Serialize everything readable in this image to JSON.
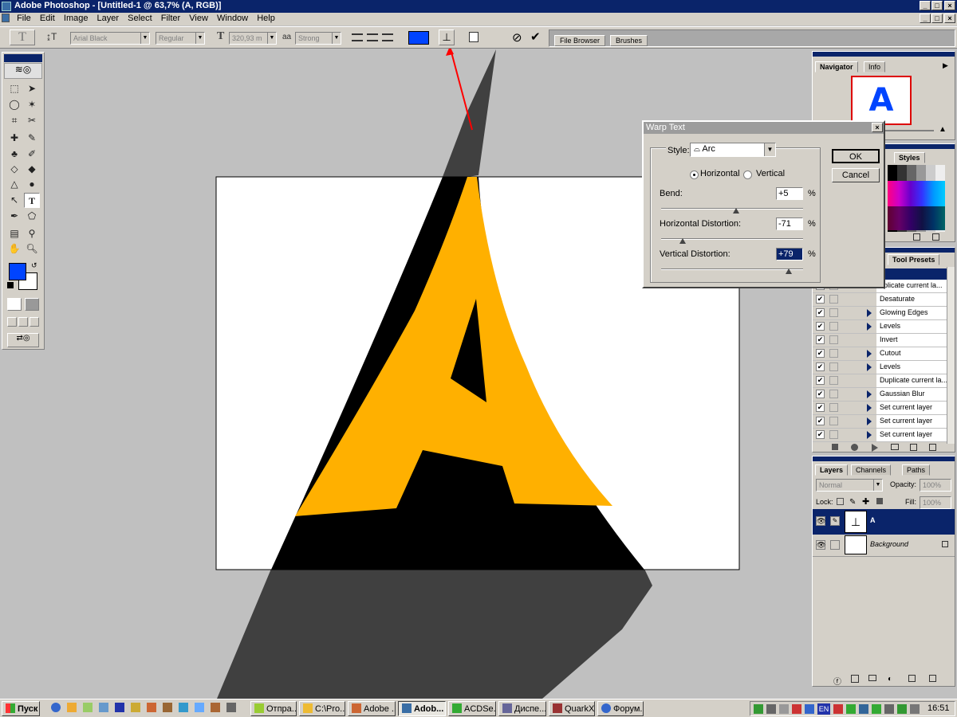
{
  "window": {
    "title": "Adobe Photoshop - [Untitled-1 @ 63,7% (A, RGB)]"
  },
  "menu": [
    "File",
    "Edit",
    "Image",
    "Layer",
    "Select",
    "Filter",
    "View",
    "Window",
    "Help"
  ],
  "options_bar": {
    "font_family": "Arial Black",
    "font_style": "Regular",
    "font_size": "320,93 m",
    "antialias_label": "aa",
    "antialias": "Strong",
    "text_color": "#0044ff",
    "tabs": [
      "File Browser",
      "Brushes"
    ]
  },
  "navigator": {
    "tabs": [
      "Navigator",
      "Info"
    ],
    "preview_letter": "A"
  },
  "swatches": {
    "tab": "Styles"
  },
  "actions": {
    "tab": "Tool Presets",
    "items": [
      {
        "label": "uplicate current la...",
        "expand": false
      },
      {
        "label": "Desaturate",
        "expand": false
      },
      {
        "label": "Glowing Edges",
        "expand": true
      },
      {
        "label": "Levels",
        "expand": true
      },
      {
        "label": "Invert",
        "expand": false
      },
      {
        "label": "Cutout",
        "expand": true
      },
      {
        "label": "Levels",
        "expand": true
      },
      {
        "label": "Duplicate current la...",
        "expand": false
      },
      {
        "label": "Gaussian Blur",
        "expand": true
      },
      {
        "label": "Set current layer",
        "expand": true
      },
      {
        "label": "Set current layer",
        "expand": true
      },
      {
        "label": "Set current layer",
        "expand": true
      }
    ]
  },
  "layers": {
    "tabs": [
      "Layers",
      "Channels",
      "Paths"
    ],
    "blend_mode": "Normal",
    "opacity_label": "Opacity:",
    "opacity": "100%",
    "lock_label": "Lock:",
    "fill_label": "Fill:",
    "fill": "100%",
    "items": [
      {
        "name": "A",
        "selected": true
      },
      {
        "name": "Background",
        "selected": false
      }
    ]
  },
  "warp_dialog": {
    "title": "Warp Text",
    "style_label": "Style:",
    "style_value": "Arc",
    "horizontal_label": "Horizontal",
    "vertical_label": "Vertical",
    "bend_label": "Bend:",
    "bend": "+5",
    "hdist_label": "Horizontal Distortion:",
    "hdist": "-71",
    "vdist_label": "Vertical Distortion:",
    "vdist": "+79",
    "percent": "%",
    "ok": "OK",
    "cancel": "Cancel",
    "bend_level": 0.52,
    "hdist_level": 0.145,
    "vdist_level": 0.895
  },
  "taskbar": {
    "start": "Пуск",
    "tasks": [
      "Отпра...",
      "C:\\Pro...",
      "Adobe ...",
      "Adob...",
      "ACDSe...",
      "Диспе...",
      "QuarkX...",
      "Форум..."
    ],
    "lang": "EN",
    "clock": "16:51"
  },
  "colors": {
    "accent": "#0a246a",
    "letter_fill": "#ffb000",
    "foreground": "#0044ff"
  }
}
